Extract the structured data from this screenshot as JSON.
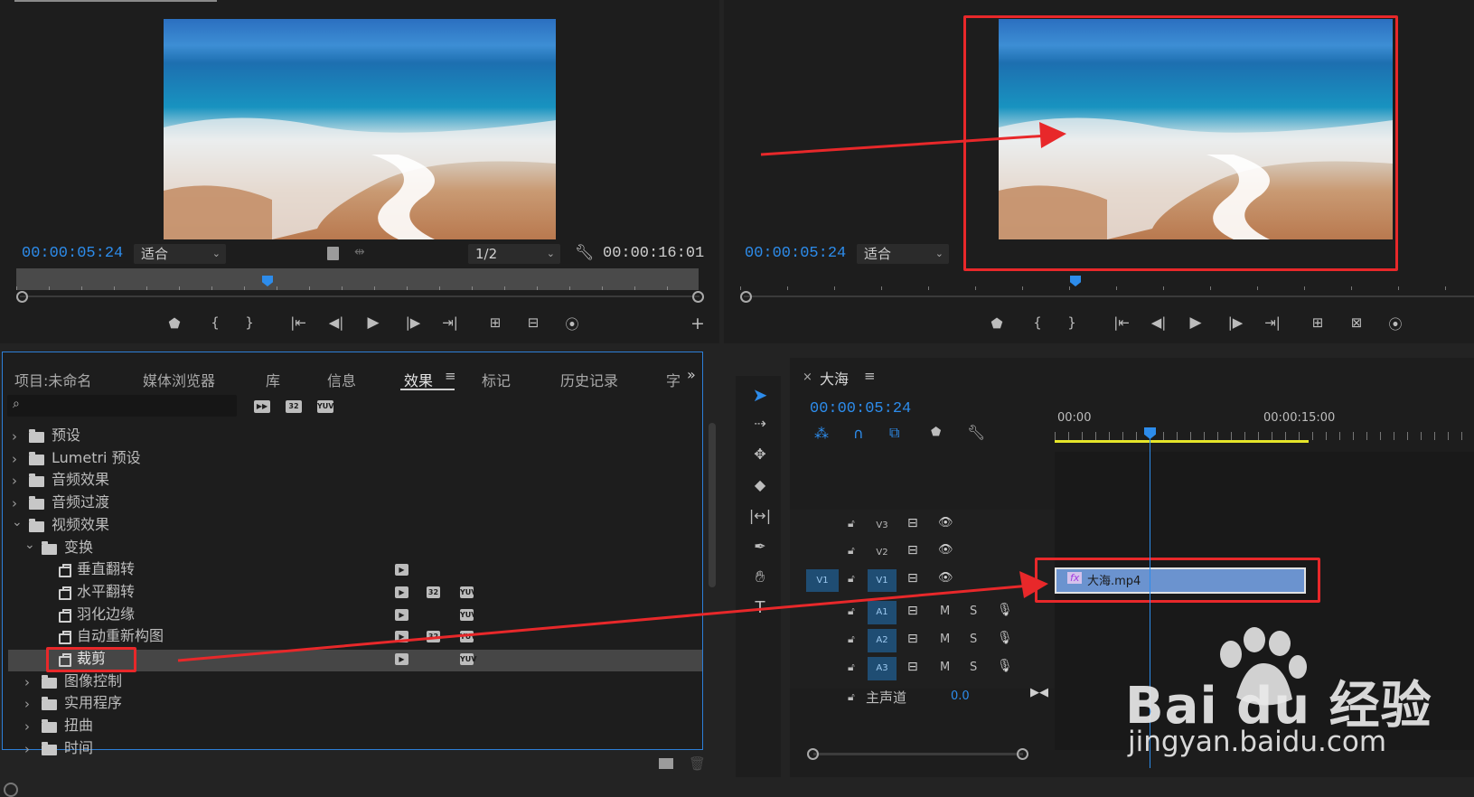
{
  "source_monitor": {
    "timecode": "00:00:05:24",
    "fit": "适合",
    "resolution": "1/2",
    "duration": "00:00:16:01"
  },
  "program_monitor": {
    "timecode": "00:00:05:24",
    "fit": "适合"
  },
  "project_panel": {
    "tabs": [
      "项目:未命名",
      "媒体浏览器",
      "库",
      "信息",
      "效果",
      "标记",
      "历史记录",
      "字"
    ],
    "active_tab": "效果",
    "search_placeholder": "",
    "tree": [
      {
        "label": "预设",
        "level": 0,
        "type": "preset-folder"
      },
      {
        "label": "Lumetri 预设",
        "level": 0,
        "type": "preset-folder"
      },
      {
        "label": "音频效果",
        "level": 0,
        "type": "folder"
      },
      {
        "label": "音频过渡",
        "level": 0,
        "type": "folder"
      },
      {
        "label": "视频效果",
        "level": 0,
        "type": "folder",
        "expanded": true
      },
      {
        "label": "变换",
        "level": 1,
        "type": "folder",
        "expanded": true
      },
      {
        "label": "垂直翻转",
        "level": 2,
        "type": "effect",
        "badges": [
          "accel"
        ]
      },
      {
        "label": "水平翻转",
        "level": 2,
        "type": "effect",
        "badges": [
          "accel",
          "32",
          "YUV"
        ]
      },
      {
        "label": "羽化边缘",
        "level": 2,
        "type": "effect",
        "badges": [
          "accel",
          "YUV"
        ]
      },
      {
        "label": "自动重新构图",
        "level": 2,
        "type": "effect",
        "badges": [
          "accel",
          "32",
          "YUV"
        ]
      },
      {
        "label": "裁剪",
        "level": 2,
        "type": "effect",
        "badges": [
          "accel",
          "YUV"
        ],
        "selected": true
      },
      {
        "label": "图像控制",
        "level": 1,
        "type": "folder"
      },
      {
        "label": "实用程序",
        "level": 1,
        "type": "folder"
      },
      {
        "label": "扭曲",
        "level": 1,
        "type": "folder"
      },
      {
        "label": "时间",
        "level": 1,
        "type": "folder"
      }
    ],
    "badge_labels": {
      "32": "32",
      "YUV": "YUV"
    }
  },
  "timeline": {
    "sequence_name": "大海",
    "timecode": "00:00:05:24",
    "ruler": [
      "00:00",
      "00:00:15:00"
    ],
    "video_tracks": [
      "V3",
      "V2",
      "V1"
    ],
    "audio_tracks": [
      "A1",
      "A2",
      "A3"
    ],
    "source_patch": "V1",
    "master_label": "主声道",
    "master_value": "0.0",
    "clip_name": "大海.mp4",
    "clip_fx": "fx",
    "mute_label": "M",
    "solo_label": "S"
  },
  "watermark": {
    "brand": "Bai du 经验",
    "url": "jingyan.baidu.com"
  },
  "colors": {
    "accent_blue": "#2d8ceb",
    "annotation_red": "#e8282a",
    "clip_blue": "#6b93cf"
  }
}
